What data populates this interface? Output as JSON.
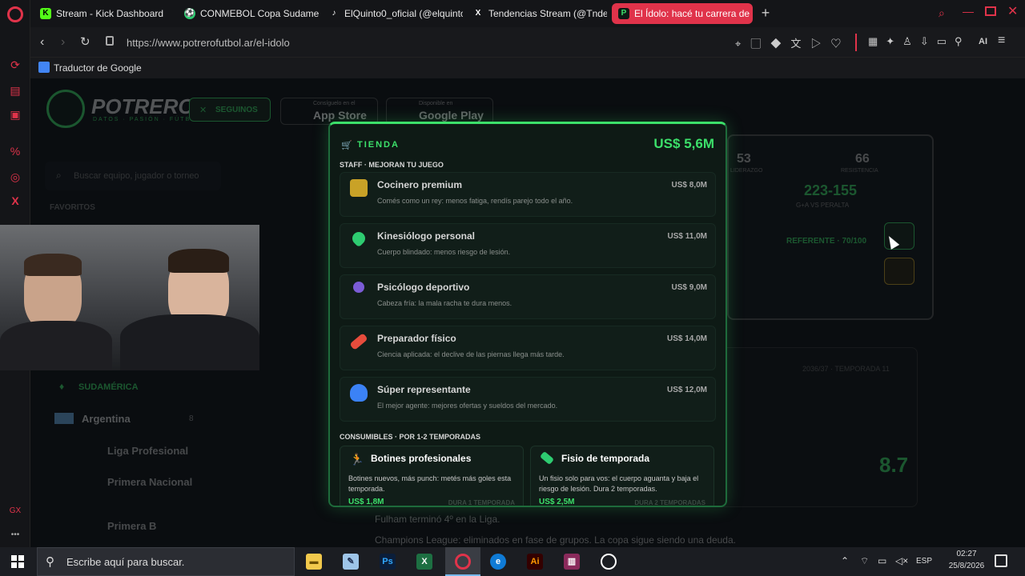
{
  "tabs": [
    {
      "label": "Stream - Kick Dashboard",
      "icon": "K",
      "color": "#53fc18"
    },
    {
      "label": "CONMEBOL Copa Sudamericana",
      "icon": "⚽",
      "color": "#2ecc71"
    },
    {
      "label": "ElQuinto0_oficial (@elquinto",
      "icon": "♪",
      "color": "#ffffff"
    },
    {
      "label": "Tendencias Stream (@Tnde",
      "icon": "X",
      "color": "#ffffff"
    },
    {
      "label": "El Ídolo: hacé tu carrera de",
      "icon": "P",
      "color": "#3ce06a"
    }
  ],
  "address": {
    "url": "https://www.potrerofutbol.ar/el-idolo"
  },
  "bookmarks": {
    "translate": "Traductor de Google"
  },
  "site": {
    "logo": "POTRERO",
    "logo_sub": "DATOS · PASIÓN · FÚTBOL",
    "follow": "SEGUINOS",
    "appstore_small": "Consíguelo en el",
    "appstore": "App Store",
    "gplay_small": "Disponible en",
    "gplay": "Google Play",
    "search_placeholder": "Buscar equipo, jugador o torneo",
    "favorites": "FAVORITOS",
    "region": "SUDAMÉRICA",
    "country": "Argentina",
    "country_count": "8",
    "leagues": [
      "Liga Profesional",
      "Primera Nacional",
      "Primera B"
    ],
    "stat1": "53",
    "stat1_label": "LIDERAZGO",
    "stat2": "66",
    "stat2_label": "RESISTENCIA",
    "record": "223-155",
    "record_label": "G+A VS PERALTA",
    "referente": "REFERENTE · 70/100",
    "season": "2036/37 · TEMPORADA 11",
    "rating": "8.7",
    "news": [
      "Fulham terminó 4º en la Liga.",
      "Champions League: eliminados en fase de grupos. La copa sigue siendo una deuda."
    ]
  },
  "store": {
    "title": "TIENDA",
    "balance": "US$ 5,6M",
    "staff_heading": "STAFF · MEJORAN TU JUEGO",
    "staff": [
      {
        "name": "Cocinero premium",
        "desc": "Comés como un rey: menos fatiga, rendís parejo todo el año.",
        "price": "US$ 8,0M",
        "icon": "chef-icon",
        "color": "#c9a227"
      },
      {
        "name": "Kinesiólogo personal",
        "desc": "Cuerpo blindado: menos riesgo de lesión.",
        "price": "US$ 11,0M",
        "icon": "heart-icon",
        "color": "#2ecc71"
      },
      {
        "name": "Psicólogo deportivo",
        "desc": "Cabeza fría: la mala racha te dura menos.",
        "price": "US$ 9,0M",
        "icon": "person-icon",
        "color": "#7b5cd6"
      },
      {
        "name": "Preparador físico",
        "desc": "Ciencia aplicada: el declive de las piernas llega más tarde.",
        "price": "US$ 14,0M",
        "icon": "dumbbell-icon",
        "color": "#e74c3c"
      },
      {
        "name": "Súper representante",
        "desc": "El mejor agente: mejores ofertas y sueldos del mercado.",
        "price": "US$ 12,0M",
        "icon": "handshake-icon",
        "color": "#3b82f6"
      }
    ],
    "consumables_heading": "CONSUMIBLES · POR 1-2 TEMPORADAS",
    "consumables": [
      {
        "name": "Botines profesionales",
        "desc": "Botines nuevos, más punch: metés más goles esta temporada.",
        "price": "US$ 1,8M",
        "duration": "DURA 1 TEMPORADA",
        "icon": "runner-icon",
        "color": "#e83e8c"
      },
      {
        "name": "Fisio de temporada",
        "desc": "Un fisio solo para vos: el cuerpo aguanta y baja el riesgo de lesión. Dura 2 temporadas.",
        "price": "US$ 2,5M",
        "duration": "DURA 2 TEMPORADAS",
        "icon": "bandage-icon",
        "color": "#2ecc71"
      }
    ]
  },
  "taskbar": {
    "search": "Escribe aquí para buscar.",
    "lang": "ESP",
    "time": "02:27",
    "date": "25/8/2026"
  }
}
